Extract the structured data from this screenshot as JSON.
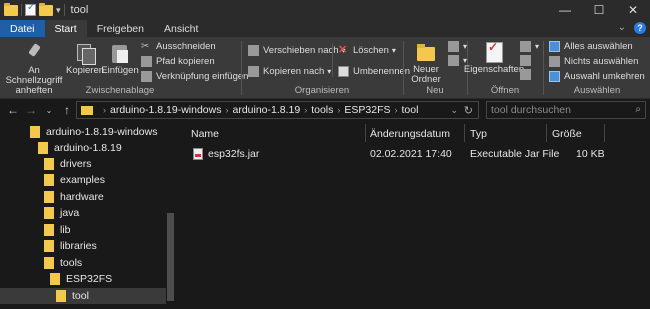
{
  "window": {
    "title": "tool",
    "controls": {
      "minimize": "—",
      "maximize": "☐",
      "close": "✕"
    }
  },
  "ribbon_tabs": [
    "Datei",
    "Start",
    "Freigeben",
    "Ansicht"
  ],
  "ribbon": {
    "clipboard": {
      "pin_label": "An Schnellzugriff anheften",
      "copy_label": "Kopieren",
      "paste_label": "Einfügen",
      "cut_label": "Ausschneiden",
      "copy_path_label": "Pfad kopieren",
      "paste_shortcut_label": "Verknüpfung einfügen",
      "group_label": "Zwischenablage"
    },
    "organize": {
      "move_to_label": "Verschieben nach",
      "copy_to_label": "Kopieren nach",
      "delete_label": "Löschen",
      "rename_label": "Umbenennen",
      "group_label": "Organisieren"
    },
    "new": {
      "new_folder_label": "Neuer Ordner",
      "group_label": "Neu"
    },
    "open": {
      "properties_label": "Eigenschaften",
      "group_label": "Öffnen"
    },
    "select": {
      "select_all_label": "Alles auswählen",
      "select_none_label": "Nichts auswählen",
      "invert_selection_label": "Auswahl umkehren",
      "group_label": "Auswählen"
    }
  },
  "address": {
    "breadcrumbs": [
      "arduino-1.8.19-windows",
      "arduino-1.8.19",
      "tools",
      "ESP32FS",
      "tool"
    ],
    "search_placeholder": "tool durchsuchen"
  },
  "nav_tree": [
    {
      "label": "arduino-1.8.19-windows",
      "selected": false
    },
    {
      "label": "arduino-1.8.19",
      "selected": false
    },
    {
      "label": "drivers",
      "selected": false
    },
    {
      "label": "examples",
      "selected": false
    },
    {
      "label": "hardware",
      "selected": false
    },
    {
      "label": "java",
      "selected": false
    },
    {
      "label": "lib",
      "selected": false
    },
    {
      "label": "libraries",
      "selected": false
    },
    {
      "label": "tools",
      "selected": false
    },
    {
      "label": "ESP32FS",
      "selected": false
    },
    {
      "label": "tool",
      "selected": true
    }
  ],
  "file_list": {
    "columns": [
      "Name",
      "Änderungsdatum",
      "Typ",
      "Größe"
    ],
    "rows": [
      {
        "name": "esp32fs.jar",
        "date": "02.02.2021 17:40",
        "type": "Executable Jar File",
        "size": "10 KB"
      }
    ]
  },
  "colors": {
    "background": "#191919",
    "ribbon": "#3a3a3a",
    "file_tab": "#1f5fa8",
    "folder": "#f2c94c"
  }
}
